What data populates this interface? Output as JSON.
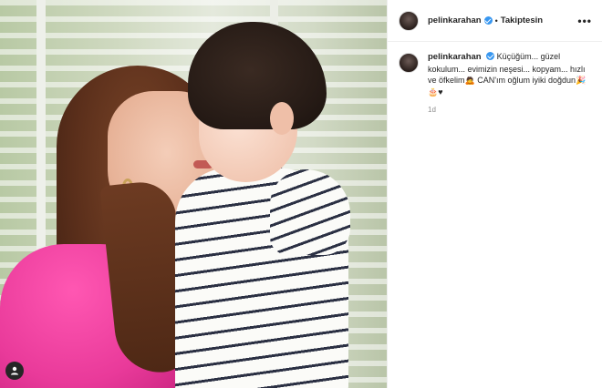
{
  "post": {
    "image_alt_icon": "user-tag-icon"
  },
  "header": {
    "username": "pelinkarahan",
    "separator": "•",
    "follow_status": "Takiptesin",
    "more_label": "•••"
  },
  "caption": {
    "username": "pelinkarahan",
    "text": "Küçüğüm... güzel kokulum... evimizin neşesi... kopyam... hızlı ve öfkelim🙇 CAN'ım oğlum iyiki doğdun🎉🎂♥",
    "time": "1d"
  },
  "colors": {
    "verified": "#3897f0",
    "muted_text": "#8e8e8e",
    "border": "#efefef"
  }
}
